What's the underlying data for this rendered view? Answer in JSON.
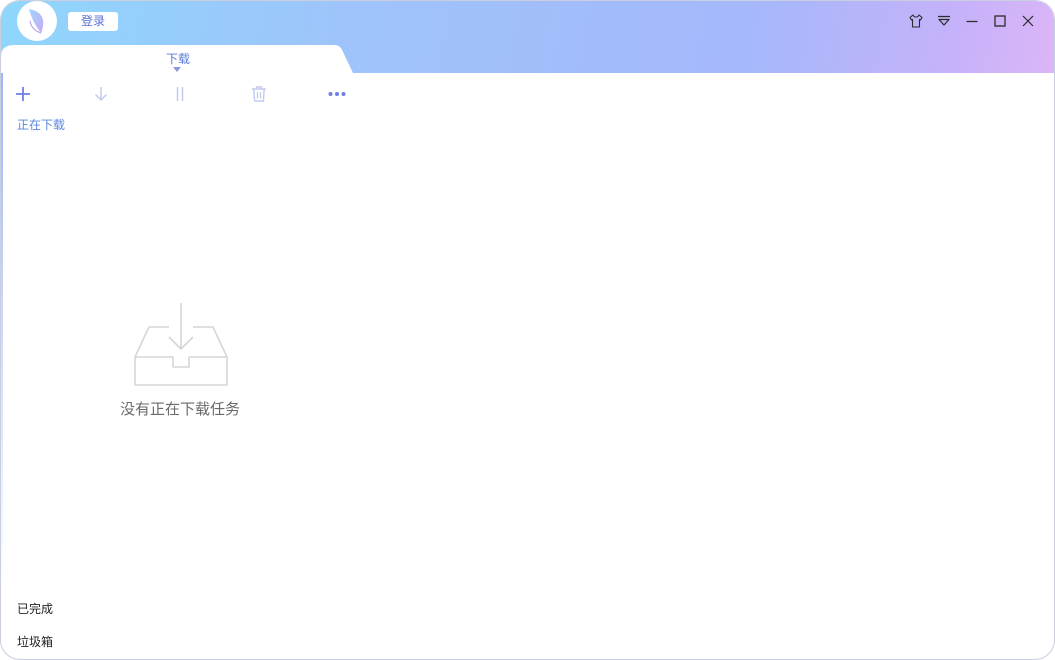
{
  "header": {
    "login_label": "登录"
  },
  "tabs": [
    {
      "label": "下载",
      "active": true
    }
  ],
  "toolbar": {
    "items": [
      {
        "icon": "plus-icon",
        "enabled": true
      },
      {
        "icon": "download-arrow-icon",
        "enabled": false
      },
      {
        "icon": "pause-icon",
        "enabled": false
      },
      {
        "icon": "trash-icon",
        "enabled": false
      },
      {
        "icon": "more-dots-icon",
        "enabled": true
      }
    ]
  },
  "sidebar": {
    "downloading_label": "正在下载",
    "completed_label": "已完成",
    "trash_label": "垃圾箱"
  },
  "empty_state": {
    "message": "没有正在下载任务"
  },
  "window_controls": [
    "skin-shirt-icon",
    "dropdown-menu-icon",
    "minimize-icon",
    "maximize-icon",
    "close-icon"
  ],
  "colors": {
    "accent": "#5b86e0",
    "header_gradient_start": "#8fd6fb",
    "header_gradient_end": "#dcb5f7",
    "disabled_icon": "#c3cbef",
    "enabled_icon": "#6f7fe3"
  }
}
